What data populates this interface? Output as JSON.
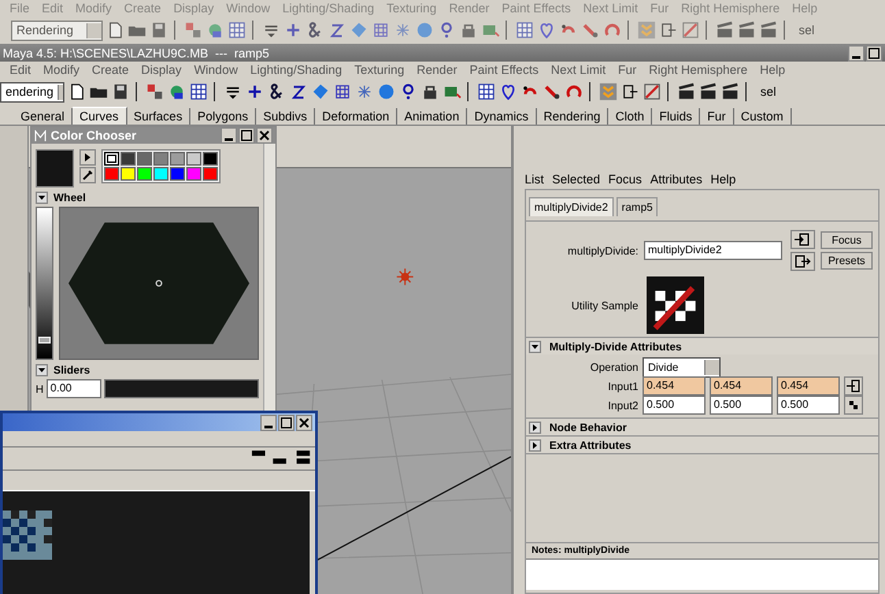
{
  "back_window": {
    "menu": [
      "File",
      "Edit",
      "Modify",
      "Create",
      "Display",
      "Window",
      "Lighting/Shading",
      "Texturing",
      "Render",
      "Paint Effects",
      "Next Limit",
      "Fur",
      "Right Hemisphere",
      "Help"
    ],
    "menu_set": "Rendering",
    "selection_label": "sel"
  },
  "window": {
    "title": "Maya 4.5: H:\\SCENES\\LAZHU9C.MB  ---  ramp5"
  },
  "menu": [
    "Edit",
    "Modify",
    "Create",
    "Display",
    "Window",
    "Lighting/Shading",
    "Texturing",
    "Render",
    "Paint Effects",
    "Next Limit",
    "Fur",
    "Right Hemisphere",
    "Help"
  ],
  "menu_set": "endering",
  "selection_label": "sel",
  "shelf_tabs": [
    {
      "label": "General",
      "selected": false
    },
    {
      "label": "Curves",
      "selected": true
    },
    {
      "label": "Surfaces",
      "selected": false
    },
    {
      "label": "Polygons",
      "selected": false
    },
    {
      "label": "Subdivs",
      "selected": false
    },
    {
      "label": "Deformation",
      "selected": false
    },
    {
      "label": "Animation",
      "selected": false
    },
    {
      "label": "Dynamics",
      "selected": false
    },
    {
      "label": "Rendering",
      "selected": false
    },
    {
      "label": "Cloth",
      "selected": false
    },
    {
      "label": "Fluids",
      "selected": false
    },
    {
      "label": "Fur",
      "selected": false
    },
    {
      "label": "Custom",
      "selected": false
    }
  ],
  "color_chooser": {
    "title": "Color Chooser",
    "swatches": [
      {
        "color": "#ffffff",
        "selected": true
      },
      {
        "color": "#3a3a3a",
        "selected": false
      },
      {
        "color": "#686868",
        "selected": false
      },
      {
        "color": "#808080",
        "selected": false
      },
      {
        "color": "#9c9c9c",
        "selected": false
      },
      {
        "color": "#cacaca",
        "selected": false
      },
      {
        "color": "#000000",
        "selected": false
      },
      {
        "color": "#ff0000",
        "selected": false
      },
      {
        "color": "#ffff00",
        "selected": false
      },
      {
        "color": "#00ff00",
        "selected": false
      },
      {
        "color": "#00ffff",
        "selected": false
      },
      {
        "color": "#0000ff",
        "selected": false
      },
      {
        "color": "#ff00ff",
        "selected": false
      },
      {
        "color": "#ff0000",
        "selected": false
      }
    ],
    "wheel_label": "Wheel",
    "value_slider": {
      "level": 0.1
    },
    "sliders_label": "Sliders",
    "h_label": "H",
    "h_value": "0.00"
  },
  "attribute_editor": {
    "menu": [
      "List",
      "Selected",
      "Focus",
      "Attributes",
      "Help"
    ],
    "tabs": [
      {
        "label": "multiplyDivide2",
        "selected": true
      },
      {
        "label": "ramp5",
        "selected": false
      }
    ],
    "node_label": "multiplyDivide:",
    "node_value": "multiplyDivide2",
    "buttons": [
      "Focus",
      "Presets"
    ],
    "sample_label": "Utility Sample",
    "sections": [
      {
        "title": "Multiply-Divide Attributes",
        "expanded": true,
        "operation": {
          "label": "Operation",
          "value": "Divide"
        },
        "inputs": [
          {
            "label": "Input1",
            "values": [
              "0.454",
              "0.454",
              "0.454"
            ],
            "connected": true
          },
          {
            "label": "Input2",
            "values": [
              "0.500",
              "0.500",
              "0.500"
            ],
            "connected": false
          }
        ]
      },
      {
        "title": "Node Behavior",
        "expanded": false
      },
      {
        "title": "Extra Attributes",
        "expanded": false
      }
    ],
    "notes_label": "Notes:  multiplyDivide"
  }
}
